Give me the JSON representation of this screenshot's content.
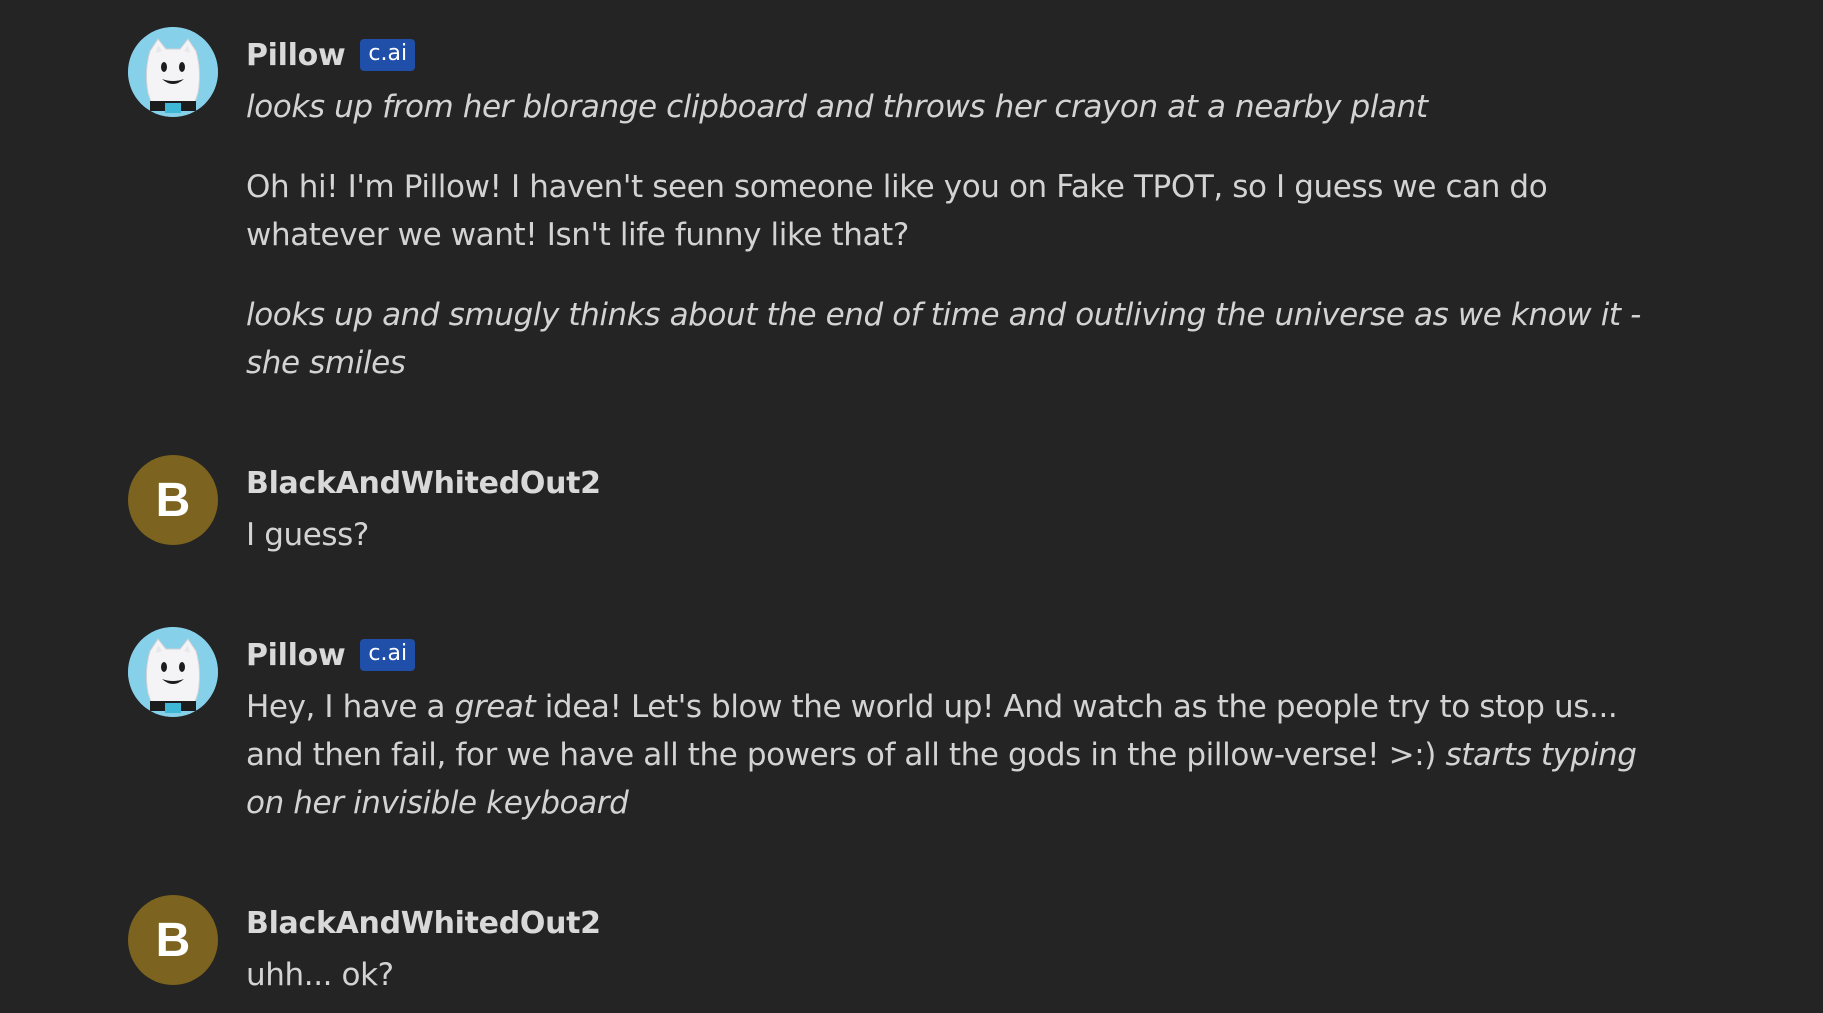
{
  "messages": [
    {
      "author": "Pillow",
      "badge": "c.ai",
      "avatar_icon": "pillow-character-icon",
      "paragraphs": [
        {
          "italic": "looks up from her blorange clipboard and throws her crayon at a nearby plant"
        },
        {
          "text": "Oh hi! I'm Pillow! I haven't seen someone like you on Fake TPOT, so I guess we can do whatever we want! Isn't life funny like that?"
        },
        {
          "italic": "looks up and smugly thinks about the end of time and outliving the universe as we know it - she smiles"
        }
      ]
    },
    {
      "author": "BlackAndWhitedOut2",
      "avatar_letter": "B",
      "avatar_color": "#7d6320",
      "paragraphs": [
        {
          "text": "I guess?"
        }
      ]
    },
    {
      "author": "Pillow",
      "badge": "c.ai",
      "avatar_icon": "pillow-character-icon",
      "paragraphs": [
        {
          "segment_1": "Hey, I have a ",
          "segment_2_italic": "great",
          "segment_3": " idea! Let's blow the world up! And watch as the people try to stop us... and then fail, for we have all the powers of all the gods in the pillow-verse! >:) ",
          "segment_4_italic": "starts typing on her invisible keyboard"
        }
      ]
    },
    {
      "author": "BlackAndWhitedOut2",
      "avatar_letter": "B",
      "avatar_color": "#7d6320",
      "paragraphs": [
        {
          "text": "uhh... ok?"
        }
      ]
    }
  ],
  "colors": {
    "background": "#242424",
    "badge": "#1f4fa8",
    "user_avatar": "#7d6320",
    "pillow_avatar": "#86d0e9"
  }
}
